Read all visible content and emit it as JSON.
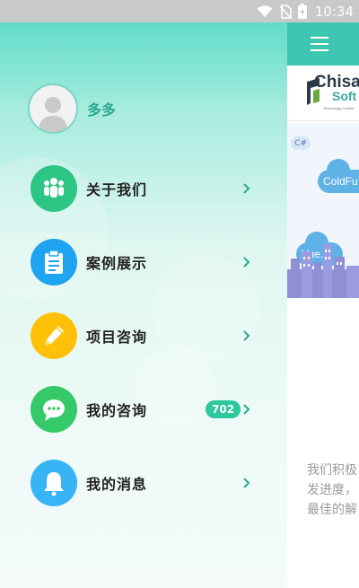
{
  "status_bar": {
    "time": "10:34",
    "icons": [
      "wifi-icon",
      "no-sim-icon",
      "battery-charging-icon"
    ]
  },
  "background_app": {
    "logo_line1": "Chisal",
    "logo_line2": "Soft",
    "logo_tagline": "Technology Limited",
    "tag_csharp": "C#",
    "cloud1": "ColdFu",
    "cloud2": "Vue.js",
    "text_lines": [
      "我们积极",
      "发进度，",
      "最佳的解"
    ]
  },
  "drawer": {
    "username": "多多",
    "menu": [
      {
        "label": "关于我们",
        "icon": "group-icon",
        "color": "#2cc584"
      },
      {
        "label": "案例展示",
        "icon": "clipboard-icon",
        "color": "#1ea4f0"
      },
      {
        "label": "项目咨询",
        "icon": "pencil-icon",
        "color": "#ffc107"
      },
      {
        "label": "我的咨询",
        "icon": "chat-bubble-icon",
        "color": "#35c96a",
        "badge": "702"
      },
      {
        "label": "我的消息",
        "icon": "bell-icon",
        "color": "#36b4f5"
      }
    ]
  },
  "colors": {
    "accent": "#3ec6b0",
    "badge": "#2fc79e"
  }
}
